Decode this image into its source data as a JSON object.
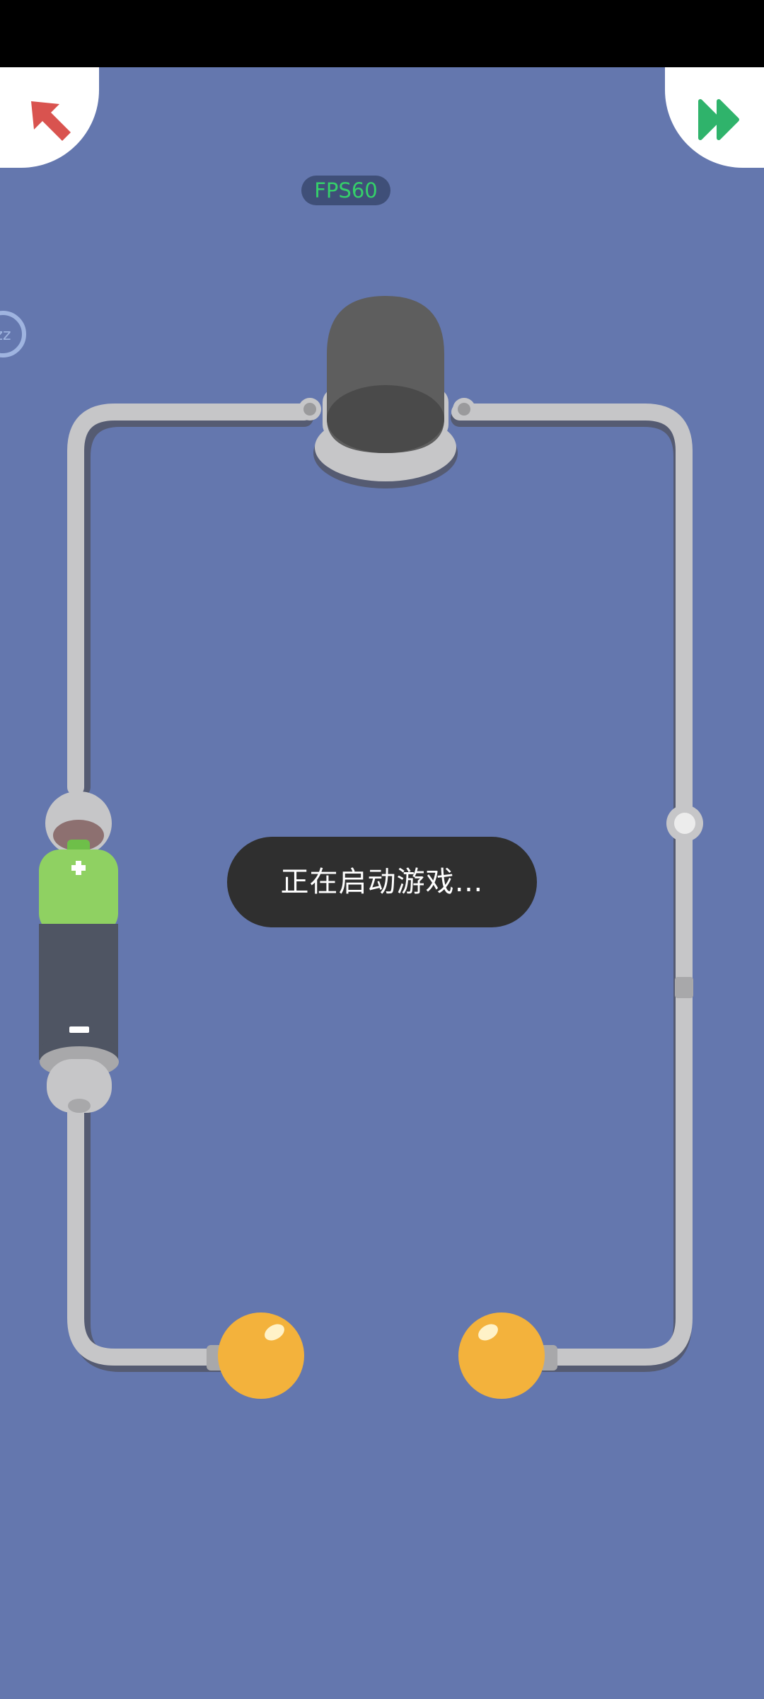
{
  "hud": {
    "fps_label": "FPS60",
    "sleep_label": "zz"
  },
  "toast": {
    "message": "正在启动游戏…"
  },
  "buttons": {
    "back_icon": "arrow-up-left-icon",
    "skip_icon": "fast-forward-icon"
  },
  "colors": {
    "background": "#6477ae",
    "wire": "#c6c6c8",
    "bulb_body": "#5e5e5e",
    "battery_positive": "#8fd162",
    "battery_negative": "#4f5563",
    "switch_knob": "#f3b23c",
    "back_arrow": "#d9534f",
    "skip_arrow": "#2fb36b",
    "fps_text": "#35d06a"
  }
}
